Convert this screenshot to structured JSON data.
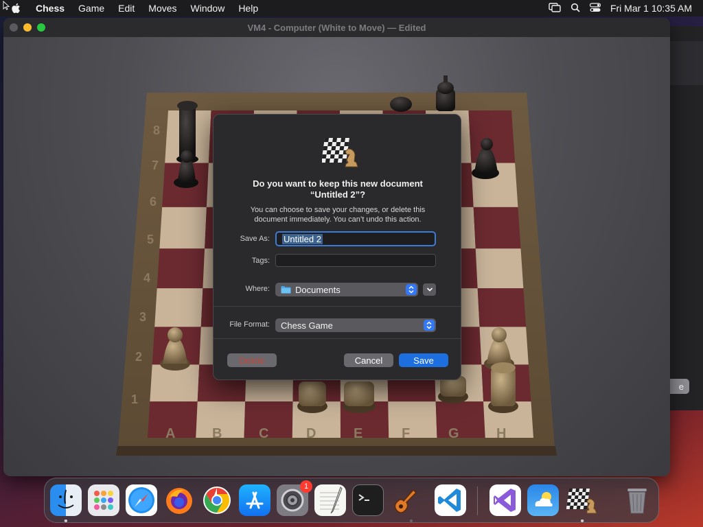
{
  "menubar": {
    "app_name": "Chess",
    "items": [
      "Game",
      "Edit",
      "Moves",
      "Window",
      "Help"
    ],
    "clock": "Fri Mar 1  10:35 AM"
  },
  "window": {
    "title": "VM4 - Computer  (White to Move) — Edited",
    "board_files": [
      "A",
      "B",
      "C",
      "D",
      "E",
      "F",
      "G",
      "H"
    ],
    "board_ranks": [
      "8",
      "7",
      "6",
      "5",
      "4",
      "3",
      "2",
      "1"
    ]
  },
  "background_window": {
    "button_fragment": "e"
  },
  "dialog": {
    "headline_line1": "Do you want to keep this new document",
    "headline_line2": "“Untitled 2”?",
    "subtext_line1": "You can choose to save your changes, or delete this",
    "subtext_line2": "document immediately. You can’t undo this action.",
    "save_as_label": "Save As:",
    "save_as_value": "Untitled 2",
    "tags_label": "Tags:",
    "where_label": "Where:",
    "where_value": "Documents",
    "file_format_label": "File Format:",
    "file_format_value": "Chess Game",
    "delete_label": "Delete",
    "cancel_label": "Cancel",
    "save_label": "Save"
  },
  "dock": {
    "settings_badge": "1",
    "apps": [
      "finder",
      "launchpad",
      "safari",
      "firefox",
      "chrome",
      "app-store",
      "system-settings",
      "textedit",
      "terminal",
      "garageband",
      "vscode",
      "visual-studio",
      "weather",
      "chess",
      "trash"
    ]
  },
  "colors": {
    "accent": "#1d6fe0",
    "destructive": "#c4453c",
    "dark_square": "#6b2a30",
    "light_square": "#c9b49a"
  }
}
